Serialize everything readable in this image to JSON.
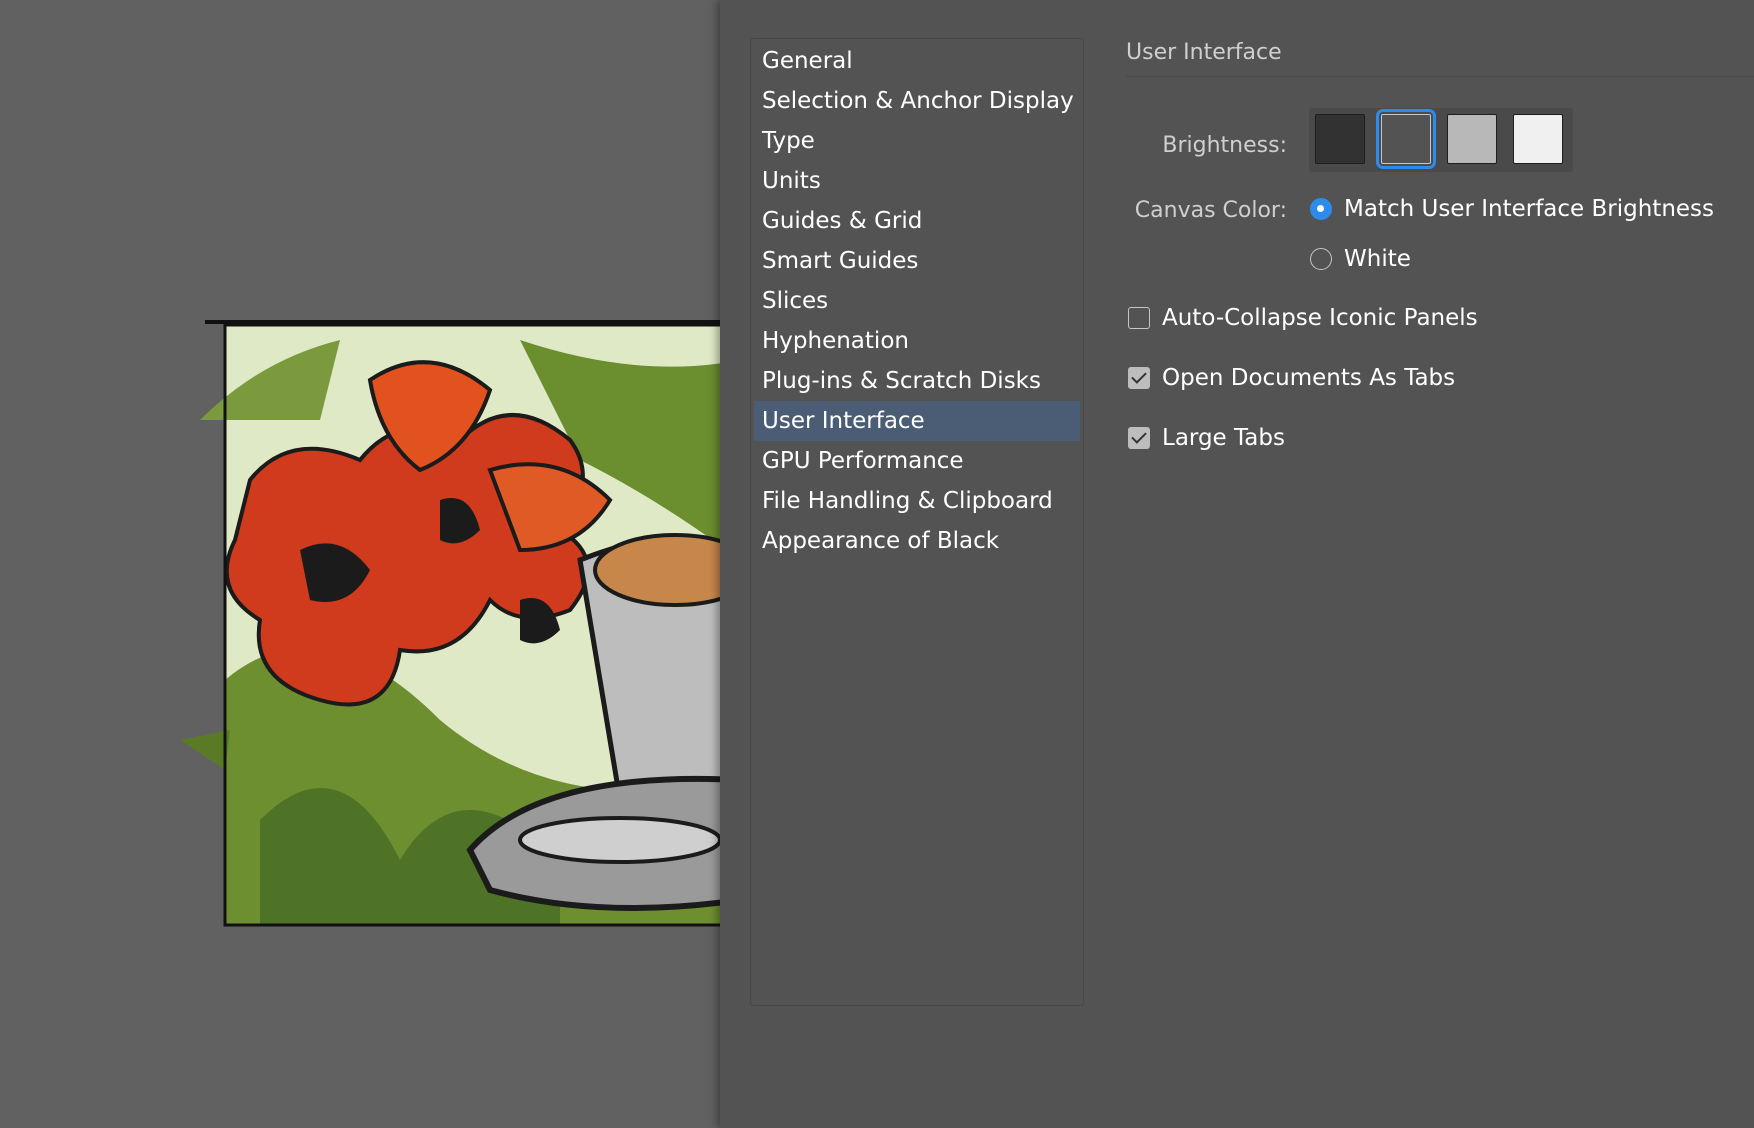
{
  "sidebar": {
    "items": [
      {
        "label": "General"
      },
      {
        "label": "Selection & Anchor Display"
      },
      {
        "label": "Type"
      },
      {
        "label": "Units"
      },
      {
        "label": "Guides & Grid"
      },
      {
        "label": "Smart Guides"
      },
      {
        "label": "Slices"
      },
      {
        "label": "Hyphenation"
      },
      {
        "label": "Plug-ins & Scratch Disks"
      },
      {
        "label": "User Interface"
      },
      {
        "label": "GPU Performance"
      },
      {
        "label": "File Handling & Clipboard"
      },
      {
        "label": "Appearance of Black"
      }
    ],
    "selected_index": 9
  },
  "panel": {
    "title": "User Interface",
    "brightness": {
      "label": "Brightness:",
      "swatch_colors": [
        "#323232",
        "#535353",
        "#b8b8b8",
        "#f0f0f0"
      ],
      "selected_index": 1
    },
    "canvas_color": {
      "label": "Canvas Color:",
      "options": [
        {
          "label": "Match User Interface Brightness",
          "selected": true
        },
        {
          "label": "White",
          "selected": false
        }
      ]
    },
    "checkboxes": [
      {
        "label": "Auto-Collapse Iconic Panels",
        "checked": false
      },
      {
        "label": "Open Documents As Tabs",
        "checked": true
      },
      {
        "label": "Large Tabs",
        "checked": true
      }
    ]
  },
  "colors": {
    "accent": "#2d8ceb",
    "selection_bg": "#4a5d75",
    "dialog_bg": "#535353",
    "canvas_bg": "#616161"
  }
}
